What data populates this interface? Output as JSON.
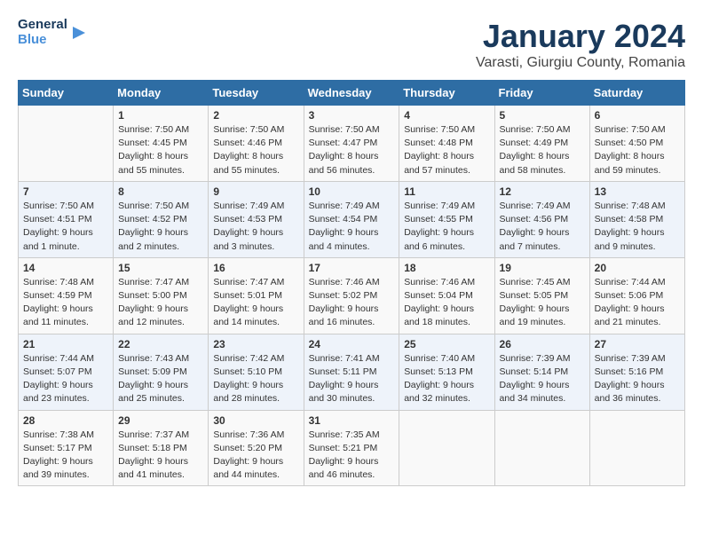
{
  "logo": {
    "line1": "General",
    "line2": "Blue"
  },
  "title": "January 2024",
  "subtitle": "Varasti, Giurgiu County, Romania",
  "days_of_week": [
    "Sunday",
    "Monday",
    "Tuesday",
    "Wednesday",
    "Thursday",
    "Friday",
    "Saturday"
  ],
  "weeks": [
    [
      null,
      {
        "day": 1,
        "sunrise": "7:50 AM",
        "sunset": "4:45 PM",
        "daylight": "8 hours and 55 minutes."
      },
      {
        "day": 2,
        "sunrise": "7:50 AM",
        "sunset": "4:46 PM",
        "daylight": "8 hours and 55 minutes."
      },
      {
        "day": 3,
        "sunrise": "7:50 AM",
        "sunset": "4:47 PM",
        "daylight": "8 hours and 56 minutes."
      },
      {
        "day": 4,
        "sunrise": "7:50 AM",
        "sunset": "4:48 PM",
        "daylight": "8 hours and 57 minutes."
      },
      {
        "day": 5,
        "sunrise": "7:50 AM",
        "sunset": "4:49 PM",
        "daylight": "8 hours and 58 minutes."
      },
      {
        "day": 6,
        "sunrise": "7:50 AM",
        "sunset": "4:50 PM",
        "daylight": "8 hours and 59 minutes."
      }
    ],
    [
      {
        "day": 7,
        "sunrise": "7:50 AM",
        "sunset": "4:51 PM",
        "daylight": "9 hours and 1 minute."
      },
      {
        "day": 8,
        "sunrise": "7:50 AM",
        "sunset": "4:52 PM",
        "daylight": "9 hours and 2 minutes."
      },
      {
        "day": 9,
        "sunrise": "7:49 AM",
        "sunset": "4:53 PM",
        "daylight": "9 hours and 3 minutes."
      },
      {
        "day": 10,
        "sunrise": "7:49 AM",
        "sunset": "4:54 PM",
        "daylight": "9 hours and 4 minutes."
      },
      {
        "day": 11,
        "sunrise": "7:49 AM",
        "sunset": "4:55 PM",
        "daylight": "9 hours and 6 minutes."
      },
      {
        "day": 12,
        "sunrise": "7:49 AM",
        "sunset": "4:56 PM",
        "daylight": "9 hours and 7 minutes."
      },
      {
        "day": 13,
        "sunrise": "7:48 AM",
        "sunset": "4:58 PM",
        "daylight": "9 hours and 9 minutes."
      }
    ],
    [
      {
        "day": 14,
        "sunrise": "7:48 AM",
        "sunset": "4:59 PM",
        "daylight": "9 hours and 11 minutes."
      },
      {
        "day": 15,
        "sunrise": "7:47 AM",
        "sunset": "5:00 PM",
        "daylight": "9 hours and 12 minutes."
      },
      {
        "day": 16,
        "sunrise": "7:47 AM",
        "sunset": "5:01 PM",
        "daylight": "9 hours and 14 minutes."
      },
      {
        "day": 17,
        "sunrise": "7:46 AM",
        "sunset": "5:02 PM",
        "daylight": "9 hours and 16 minutes."
      },
      {
        "day": 18,
        "sunrise": "7:46 AM",
        "sunset": "5:04 PM",
        "daylight": "9 hours and 18 minutes."
      },
      {
        "day": 19,
        "sunrise": "7:45 AM",
        "sunset": "5:05 PM",
        "daylight": "9 hours and 19 minutes."
      },
      {
        "day": 20,
        "sunrise": "7:44 AM",
        "sunset": "5:06 PM",
        "daylight": "9 hours and 21 minutes."
      }
    ],
    [
      {
        "day": 21,
        "sunrise": "7:44 AM",
        "sunset": "5:07 PM",
        "daylight": "9 hours and 23 minutes."
      },
      {
        "day": 22,
        "sunrise": "7:43 AM",
        "sunset": "5:09 PM",
        "daylight": "9 hours and 25 minutes."
      },
      {
        "day": 23,
        "sunrise": "7:42 AM",
        "sunset": "5:10 PM",
        "daylight": "9 hours and 28 minutes."
      },
      {
        "day": 24,
        "sunrise": "7:41 AM",
        "sunset": "5:11 PM",
        "daylight": "9 hours and 30 minutes."
      },
      {
        "day": 25,
        "sunrise": "7:40 AM",
        "sunset": "5:13 PM",
        "daylight": "9 hours and 32 minutes."
      },
      {
        "day": 26,
        "sunrise": "7:39 AM",
        "sunset": "5:14 PM",
        "daylight": "9 hours and 34 minutes."
      },
      {
        "day": 27,
        "sunrise": "7:39 AM",
        "sunset": "5:16 PM",
        "daylight": "9 hours and 36 minutes."
      }
    ],
    [
      {
        "day": 28,
        "sunrise": "7:38 AM",
        "sunset": "5:17 PM",
        "daylight": "9 hours and 39 minutes."
      },
      {
        "day": 29,
        "sunrise": "7:37 AM",
        "sunset": "5:18 PM",
        "daylight": "9 hours and 41 minutes."
      },
      {
        "day": 30,
        "sunrise": "7:36 AM",
        "sunset": "5:20 PM",
        "daylight": "9 hours and 44 minutes."
      },
      {
        "day": 31,
        "sunrise": "7:35 AM",
        "sunset": "5:21 PM",
        "daylight": "9 hours and 46 minutes."
      },
      null,
      null,
      null
    ]
  ]
}
